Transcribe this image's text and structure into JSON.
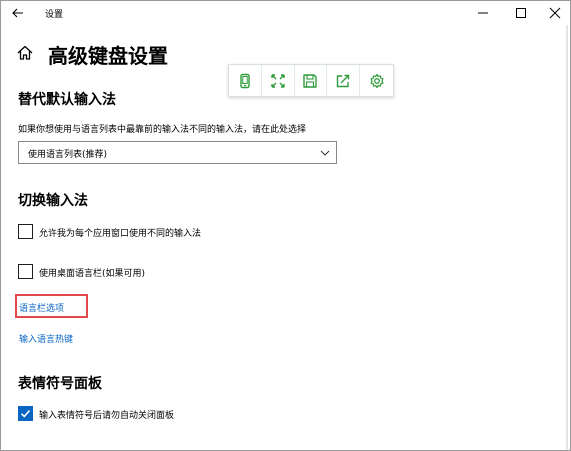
{
  "window": {
    "title": "设置"
  },
  "page": {
    "title": "高级键盘设置"
  },
  "floating_toolbar": {
    "icons": [
      "phone-icon",
      "expand-icon",
      "save-icon",
      "share-icon",
      "settings-gear-icon"
    ],
    "accent": "#2e9c3a"
  },
  "sections": {
    "override": {
      "heading": "替代默认输入法",
      "description": "如果你想使用与语言列表中最靠前的输入法不同的输入法，请在此处选择",
      "select_value": "使用语言列表(推荐)"
    },
    "switch": {
      "heading": "切换输入法",
      "option_per_app": "允许我为每个应用窗口使用不同的输入法",
      "option_per_app_checked": false,
      "option_desktop_bar": "使用桌面语言栏(如果可用)",
      "option_desktop_bar_checked": false,
      "link_language_bar": "语言栏选项",
      "link_hotkeys": "输入语言热键"
    },
    "emoji": {
      "heading": "表情符号面板",
      "option_auto_close": "输入表情符号后请勿自动关闭面板",
      "option_auto_close_checked": true
    }
  },
  "colors": {
    "link": "#0a66c2",
    "highlight": "#e24a4a",
    "checkbox_checked": "#0a66c2"
  }
}
